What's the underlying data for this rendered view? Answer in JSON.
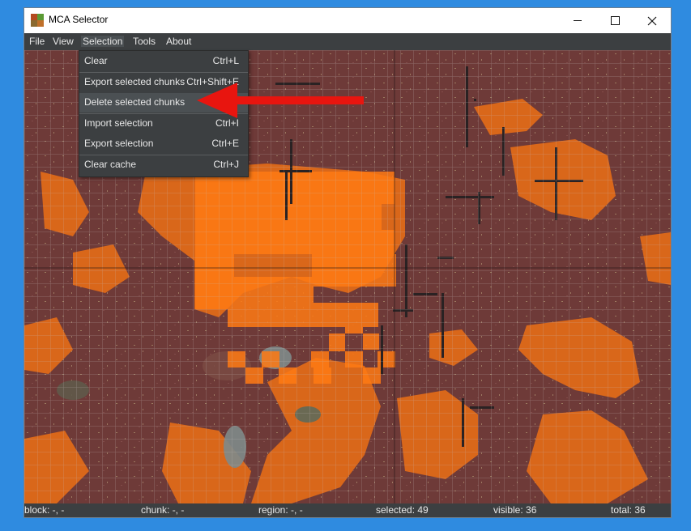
{
  "window": {
    "title": "MCA Selector"
  },
  "titlebar_icons": [
    "app-icon",
    "minimize-icon",
    "maximize-icon",
    "close-icon"
  ],
  "menubar": {
    "items": [
      {
        "label": "File"
      },
      {
        "label": "View"
      },
      {
        "label": "Selection"
      },
      {
        "label": "Tools"
      },
      {
        "label": "About"
      }
    ]
  },
  "selection_menu": {
    "items": [
      {
        "label": "Clear",
        "shortcut": "Ctrl+L"
      },
      {
        "label": "Export selected chunks",
        "shortcut": "Ctrl+Shift+E"
      },
      {
        "label": "Delete selected chunks",
        "shortcut": ""
      },
      {
        "label": "Import selection",
        "shortcut": "Ctrl+I"
      },
      {
        "label": "Export selection",
        "shortcut": "Ctrl+E"
      },
      {
        "label": "Clear cache",
        "shortcut": "Ctrl+J"
      }
    ],
    "highlighted": "Delete selected chunks"
  },
  "annotation": {
    "icon": "red-arrow-icon",
    "color": "#e8150f"
  },
  "status": {
    "block": "block: -, -",
    "chunk": "chunk: -, -",
    "region": "region: -, -",
    "selected": "selected: 49",
    "visible": "visible: 36",
    "total": "total: 36"
  },
  "colors": {
    "terrain": "#6e3a38",
    "lava": "#d9671a",
    "selection": "#ff7a14",
    "menu_background": "#3c3f41",
    "desktop": "#2f8be0"
  }
}
